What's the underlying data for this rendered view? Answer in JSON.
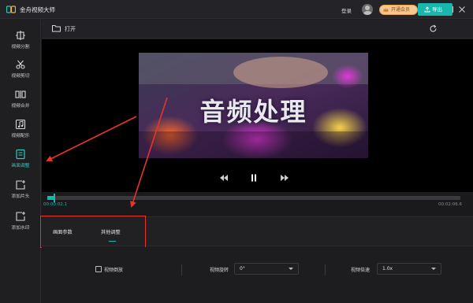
{
  "app": {
    "title": "金舟视频大师",
    "login_label": "登录",
    "vip_label": "开通会员",
    "window_buttons": [
      "menu-icon",
      "minimize-icon",
      "maximize-icon",
      "close-icon"
    ]
  },
  "colors": {
    "accent": "#17b7ae",
    "annotation_red": "#e8332a",
    "background": "#1d1d1f",
    "vip": "#f5c893"
  },
  "sidebar": {
    "items": [
      {
        "label": "视频分割",
        "icon": "split-icon"
      },
      {
        "label": "视频剪切",
        "icon": "scissors-icon"
      },
      {
        "label": "视频合并",
        "icon": "merge-icon"
      },
      {
        "label": "视频配乐",
        "icon": "music-icon"
      },
      {
        "label": "画面调整",
        "icon": "picture-adjust-icon",
        "active": true
      },
      {
        "label": "添加片头",
        "icon": "add-intro-icon"
      },
      {
        "label": "添加水印",
        "icon": "watermark-icon"
      }
    ]
  },
  "toolbar": {
    "open_label": "打开",
    "export_label": "导出"
  },
  "preview": {
    "caption": "音频处理"
  },
  "timeline": {
    "current_time": "00:00:02.1",
    "total_time": "00:02:06.6",
    "progress": 0.017
  },
  "tabs": {
    "items": [
      "画面参数",
      "其他调整"
    ],
    "active_index": 1
  },
  "settings": {
    "reverse_label": "视频倒放",
    "reverse_checked": false,
    "rotate_label": "视频旋转",
    "rotate_value": "0°",
    "speed_label": "视频倍速",
    "speed_value": "1.0x"
  }
}
